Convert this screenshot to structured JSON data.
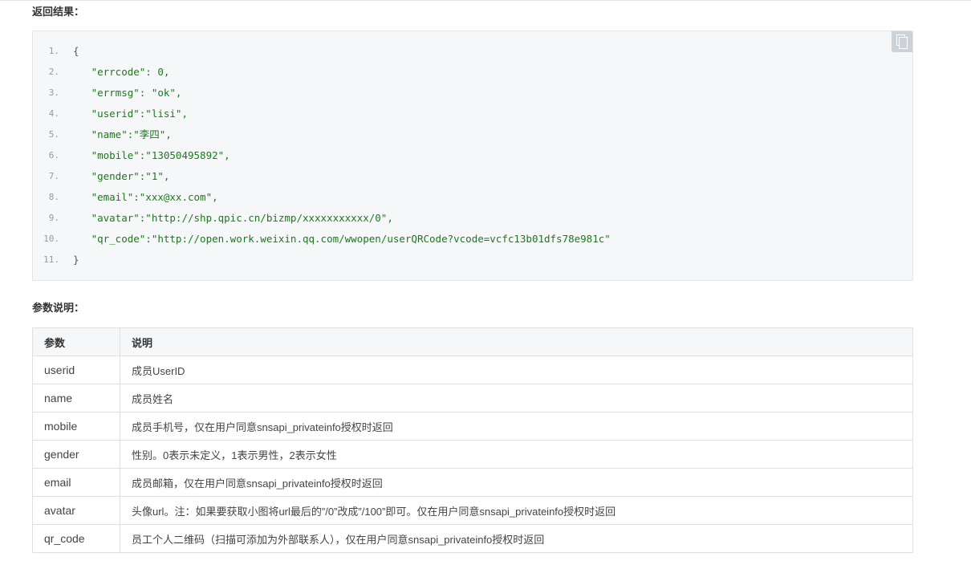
{
  "sections": {
    "result_title": "返回结果：",
    "params_title": "参数说明："
  },
  "code": {
    "lines": [
      {
        "num": "1.",
        "text": "{"
      },
      {
        "num": "2.",
        "text": "   \"errcode\": 0,"
      },
      {
        "num": "3.",
        "text": "   \"errmsg\": \"ok\","
      },
      {
        "num": "4.",
        "text": "   \"userid\":\"lisi\","
      },
      {
        "num": "5.",
        "text": "   \"name\":\"李四\","
      },
      {
        "num": "6.",
        "text": "   \"mobile\":\"13050495892\","
      },
      {
        "num": "7.",
        "text": "   \"gender\":\"1\","
      },
      {
        "num": "8.",
        "text": "   \"email\":\"xxx@xx.com\","
      },
      {
        "num": "9.",
        "text": "   \"avatar\":\"http://shp.qpic.cn/bizmp/xxxxxxxxxxx/0\","
      },
      {
        "num": "10.",
        "text": "   \"qr_code\":\"http://open.work.weixin.qq.com/wwopen/userQRCode?vcode=vcfc13b01dfs78e981c\""
      },
      {
        "num": "11.",
        "text": "}"
      }
    ],
    "copy_icon": "copy-icon"
  },
  "table": {
    "headers": [
      "参数",
      "说明"
    ],
    "rows": [
      [
        "userid",
        "成员UserID"
      ],
      [
        "name",
        "成员姓名"
      ],
      [
        "mobile",
        "成员手机号，仅在用户同意snsapi_privateinfo授权时返回"
      ],
      [
        "gender",
        "性别。0表示未定义，1表示男性，2表示女性"
      ],
      [
        "email",
        "成员邮箱，仅在用户同意snsapi_privateinfo授权时返回"
      ],
      [
        "avatar",
        "头像url。注：如果要获取小图将url最后的”/0”改成”/100”即可。仅在用户同意snsapi_privateinfo授权时返回"
      ],
      [
        "qr_code",
        "员工个人二维码（扫描可添加为外部联系人），仅在用户同意snsapi_privateinfo授权时返回"
      ]
    ]
  },
  "colors": {
    "code_string": "#1a7a1a",
    "code_background": "#f6f7f9",
    "border": "#dcdfe4"
  }
}
